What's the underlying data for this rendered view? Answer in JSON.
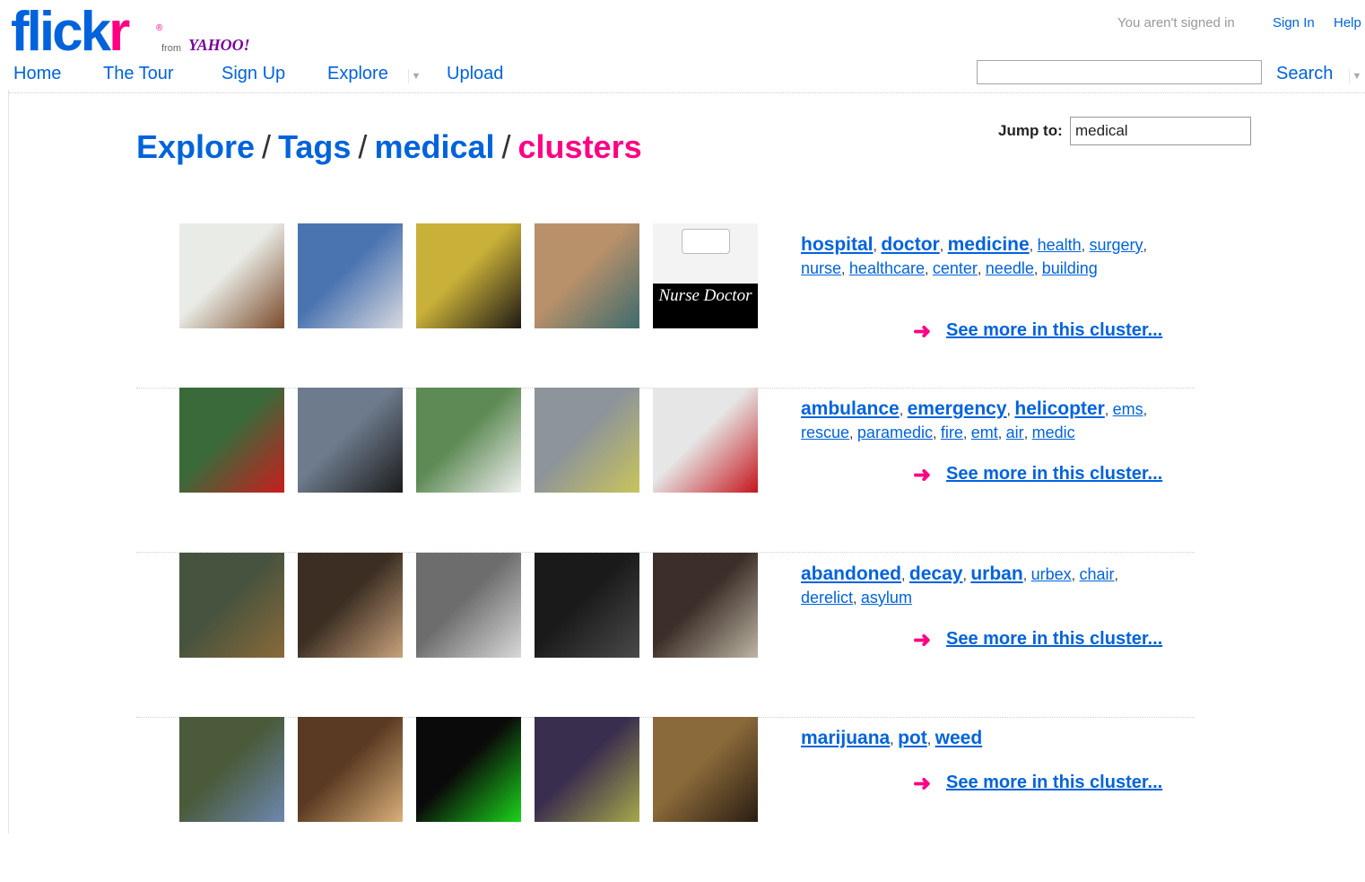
{
  "logo": {
    "word_main": "flick",
    "word_r": "r",
    "reg": "®",
    "from": "from",
    "yahoo": "YAHOO!"
  },
  "header": {
    "status": "You aren't signed in",
    "sign_in": "Sign In",
    "help": "Help",
    "nav": [
      "Home",
      "The Tour",
      "Sign Up",
      "Explore",
      "Upload"
    ],
    "search_label": "Search",
    "search_value": ""
  },
  "breadcrumb": {
    "explore": "Explore",
    "tags": "Tags",
    "tag": "medical",
    "current": "clusters",
    "sep": "/"
  },
  "jump": {
    "label": "Jump to:",
    "value": "medical"
  },
  "see_more": "See more in this cluster...",
  "clusters": [
    {
      "tags_big": [
        "hospital",
        "doctor",
        "medicine"
      ],
      "tags_small": [
        "health",
        "surgery",
        "nurse",
        "healthcare",
        "center",
        "needle",
        "building"
      ],
      "thumbs": [
        {
          "name": "cartoon-doctor-thumb",
          "bg": "#e9ece6",
          "accent": "#7a4a2a"
        },
        {
          "name": "stethoscope-thumb",
          "bg": "#4a74b0",
          "accent": "#d9d9e0"
        },
        {
          "name": "syringes-thumb",
          "bg": "#c9b038",
          "accent": "#1e1a16"
        },
        {
          "name": "nurse-needle-thumb",
          "bg": "#b8906a",
          "accent": "#3d6b6e"
        },
        {
          "name": "nurse-doctor-sign-thumb",
          "bg": "#f2f2f2",
          "accent": "#111111",
          "caption": "Nurse Doctor"
        }
      ]
    },
    {
      "tags_big": [
        "ambulance",
        "emergency",
        "helicopter"
      ],
      "tags_small": [
        "ems",
        "rescue",
        "paramedic",
        "fire",
        "emt",
        "air",
        "medic"
      ],
      "thumbs": [
        {
          "name": "red-ambulance-thumb",
          "bg": "#3a6a3a",
          "accent": "#c81e1e"
        },
        {
          "name": "utility-cart-thumb",
          "bg": "#6d7b8c",
          "accent": "#1c1c1c"
        },
        {
          "name": "police-car-thumb",
          "bg": "#5e8a55",
          "accent": "#f0f0f0"
        },
        {
          "name": "street-ambulance-thumb",
          "bg": "#8d949a",
          "accent": "#c9c45a"
        },
        {
          "name": "amr-ambulance-thumb",
          "bg": "#e6e6e6",
          "accent": "#c4161c"
        }
      ]
    },
    {
      "tags_big": [
        "abandoned",
        "decay",
        "urban"
      ],
      "tags_small": [
        "urbex",
        "chair",
        "derelict",
        "asylum"
      ],
      "thumbs": [
        {
          "name": "abandoned-bed-thumb",
          "bg": "#46533e",
          "accent": "#8a6a3a"
        },
        {
          "name": "prosthetic-leg-thumb",
          "bg": "#3c2e22",
          "accent": "#c9a27d"
        },
        {
          "name": "bw-room-thumb",
          "bg": "#6d6d6d",
          "accent": "#d8d8d8"
        },
        {
          "name": "dark-room-thumb",
          "bg": "#1a1a1a",
          "accent": "#4a4a4a"
        },
        {
          "name": "lockers-thumb",
          "bg": "#3c2f29",
          "accent": "#bdb4a3"
        }
      ]
    },
    {
      "tags_big": [
        "marijuana",
        "pot",
        "weed"
      ],
      "tags_small": [],
      "thumbs": [
        {
          "name": "bud-on-scale-thumb",
          "bg": "#4a5a3a",
          "accent": "#6d88b0"
        },
        {
          "name": "rx-jar-thumb",
          "bg": "#5a3a22",
          "accent": "#d9b07a"
        },
        {
          "name": "medical-neon-thumb",
          "bg": "#0a0a0a",
          "accent": "#1bd41b"
        },
        {
          "name": "bud-closeup-thumb",
          "bg": "#3a2e4e",
          "accent": "#a5a84a"
        },
        {
          "name": "speaker-podium-thumb",
          "bg": "#8a6a3a",
          "accent": "#2a1d12"
        }
      ]
    }
  ]
}
